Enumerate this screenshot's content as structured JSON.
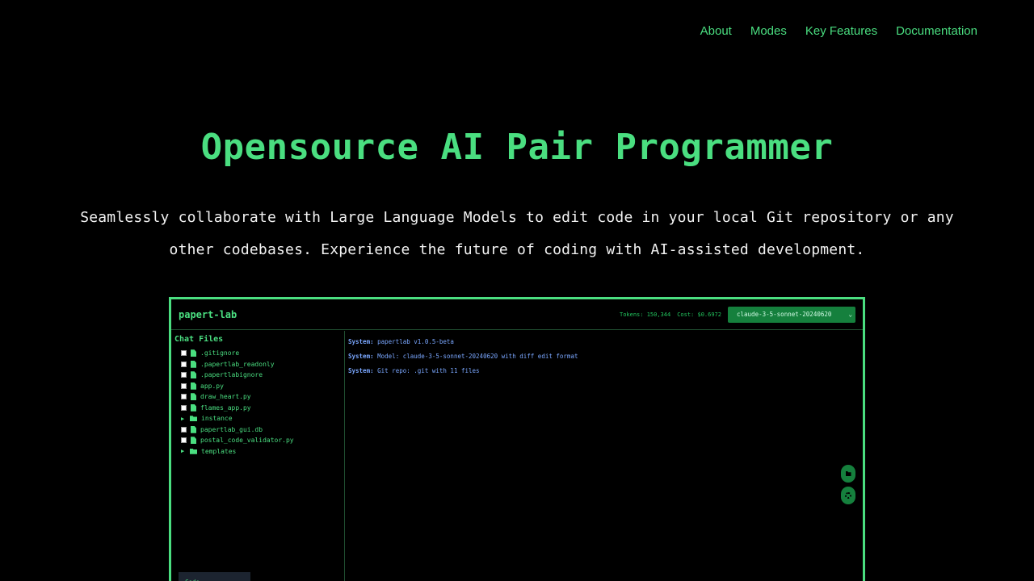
{
  "nav": {
    "about": "About",
    "modes": "Modes",
    "features": "Key Features",
    "docs": "Documentation"
  },
  "hero": {
    "title": "Opensource AI Pair Programmer",
    "subtitle": "Seamlessly collaborate with Large Language Models to edit code in your local Git repository or any other codebases. Experience the future of coding with AI-assisted development."
  },
  "app": {
    "title": "papert-lab",
    "tokens": "Tokens: 150,344",
    "cost": "Cost: $0.6972",
    "model": "claude-3-5-sonnet-20240620",
    "sidebar": {
      "title": "Chat Files",
      "items": [
        {
          "type": "file",
          "name": ".gitignore"
        },
        {
          "type": "file",
          "name": ".papertlab_readonly"
        },
        {
          "type": "file",
          "name": ".papertlabignore"
        },
        {
          "type": "file",
          "name": "app.py"
        },
        {
          "type": "file",
          "name": "draw_heart.py"
        },
        {
          "type": "file",
          "name": "flames_app.py"
        },
        {
          "type": "folder",
          "name": "instance"
        },
        {
          "type": "file",
          "name": "papertlab_gui.db"
        },
        {
          "type": "file",
          "name": "postal_code_validator.py"
        },
        {
          "type": "folder",
          "name": "templates"
        }
      ],
      "code_tab": "Code"
    },
    "chat": {
      "messages": [
        {
          "label": "System:",
          "text": "papertlab v1.0.5-beta"
        },
        {
          "label": "System:",
          "text": "Model: claude-3-5-sonnet-20240620 with diff edit format"
        },
        {
          "label": "System:",
          "text": "Git repo: .git with 11 files"
        }
      ]
    },
    "icons": {
      "folder_button": "folder-icon",
      "settings_button": "gear-icon"
    }
  },
  "colors": {
    "accent": "#4ade80",
    "background": "#000000",
    "system_text": "#7aa7ff",
    "select_bg": "#15803d"
  }
}
